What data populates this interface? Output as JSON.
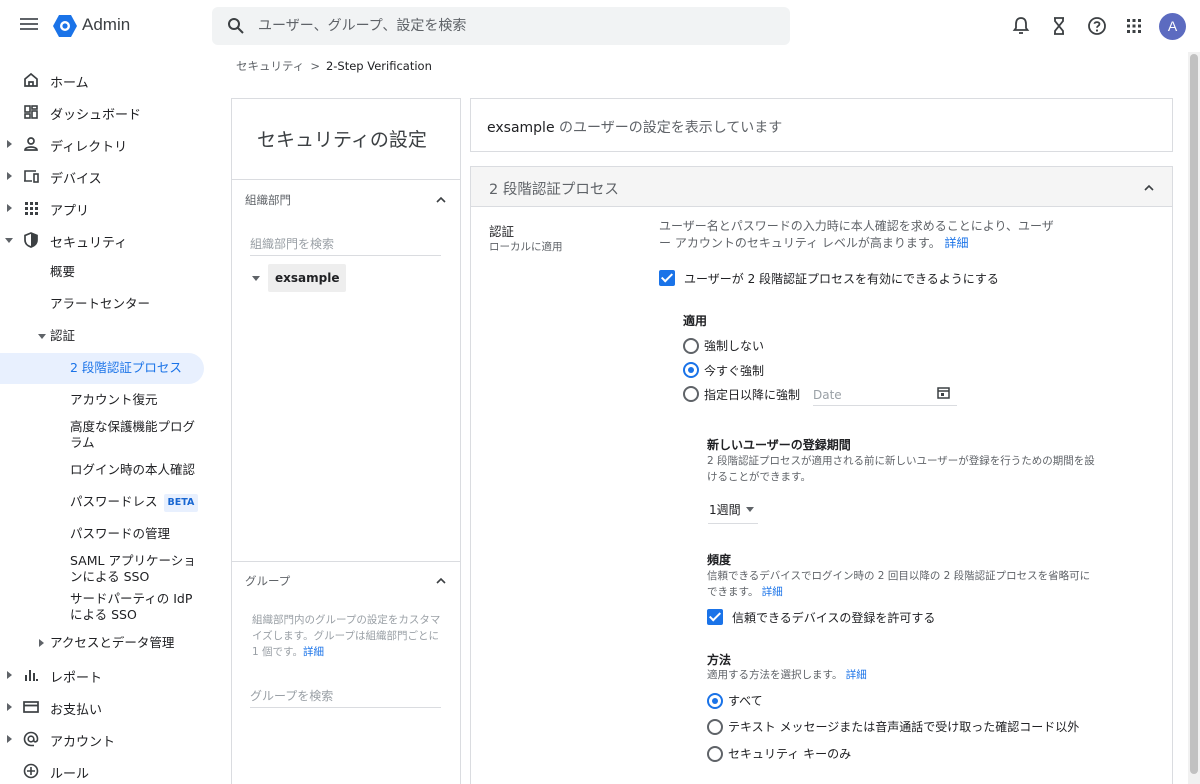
{
  "header": {
    "app_name": "Admin",
    "search_placeholder": "ユーザー、グループ、設定を検索",
    "avatar_letter": "A",
    "colors": {
      "brand": "#1a73e8",
      "avatar": "#5c6bc0"
    }
  },
  "sidebar": {
    "items": [
      {
        "label": "ホーム",
        "icon": "home-icon"
      },
      {
        "label": "ダッシュボード",
        "icon": "dashboard-icon"
      },
      {
        "label": "ディレクトリ",
        "icon": "person-icon"
      },
      {
        "label": "デバイス",
        "icon": "devices-icon"
      },
      {
        "label": "アプリ",
        "icon": "apps-grid-icon"
      },
      {
        "label": "セキュリティ",
        "icon": "shield-icon"
      }
    ],
    "security_sub": [
      {
        "label": "概要"
      },
      {
        "label": "アラートセンター"
      },
      {
        "label": "認証"
      }
    ],
    "auth_sub": [
      {
        "label": "2 段階認証プロセス"
      },
      {
        "label": "アカウント復元"
      },
      {
        "label": "高度な保護機能プログラム"
      },
      {
        "label": "ログイン時の本人確認"
      },
      {
        "label": "パスワードレス",
        "badge": "BETA"
      },
      {
        "label": "パスワードの管理"
      },
      {
        "label": "SAML アプリケーションによる SSO"
      },
      {
        "label": "サードパーティの IdP による SSO"
      }
    ],
    "access_label": "アクセスとデータ管理",
    "bottom_items": [
      {
        "label": "レポート",
        "icon": "bar-chart-icon"
      },
      {
        "label": "お支払い",
        "icon": "credit-card-icon"
      },
      {
        "label": "アカウント",
        "icon": "at-sign-icon"
      },
      {
        "label": "ルール",
        "icon": "rules-icon"
      }
    ]
  },
  "breadcrumb": {
    "parent": "セキュリティ",
    "separator": ">",
    "current": "2-Step Verification"
  },
  "left_panel": {
    "title": "セキュリティの設定",
    "org_section": "組織部門",
    "org_search_placeholder": "組織部門を検索",
    "org_node": "exsample",
    "group_section": "グループ",
    "group_desc": "組織部門内のグループの設定をカスタマイズします。グループは組織部門ごとに 1 個です。",
    "group_desc_link": "詳細",
    "group_search_placeholder": "グループを検索"
  },
  "info_bar": {
    "org": "exsample",
    "text": " のユーザーの設定を表示しています"
  },
  "card": {
    "title": "2 段階認証プロセス",
    "auth_label": "認証",
    "auth_sub": "ローカルに適用",
    "desc": "ユーザー名とパスワードの入力時に本人確認を求めることにより、ユーザー アカウントのセキュリティ レベルが高まります。",
    "desc_link": "詳細",
    "enable_label": "ユーザーが 2 段階認証プロセスを有効にできるようにする",
    "enforce_title": "適用",
    "enforce_options": [
      "強制しない",
      "今すぐ強制",
      "指定日以降に強制"
    ],
    "enforce_selected": 1,
    "date_placeholder": "Date",
    "enroll_title": "新しいユーザーの登録期間",
    "enroll_desc": "2 段階認証プロセスが適用される前に新しいユーザーが登録を行うための期間を設けることができます。",
    "enroll_value": "1週間",
    "freq_title": "頻度",
    "freq_desc": "信頼できるデバイスでログイン時の 2 回目以降の 2 段階認証プロセスを省略可にできます。",
    "freq_link": "詳細",
    "trust_label": "信頼できるデバイスの登録を許可する",
    "method_title": "方法",
    "method_desc": "適用する方法を選択します。",
    "method_link": "詳細",
    "method_options": [
      "すべて",
      "テキスト メッセージまたは音声通話で受け取った確認コード以外",
      "セキュリティ キーのみ"
    ],
    "method_selected": 0
  }
}
